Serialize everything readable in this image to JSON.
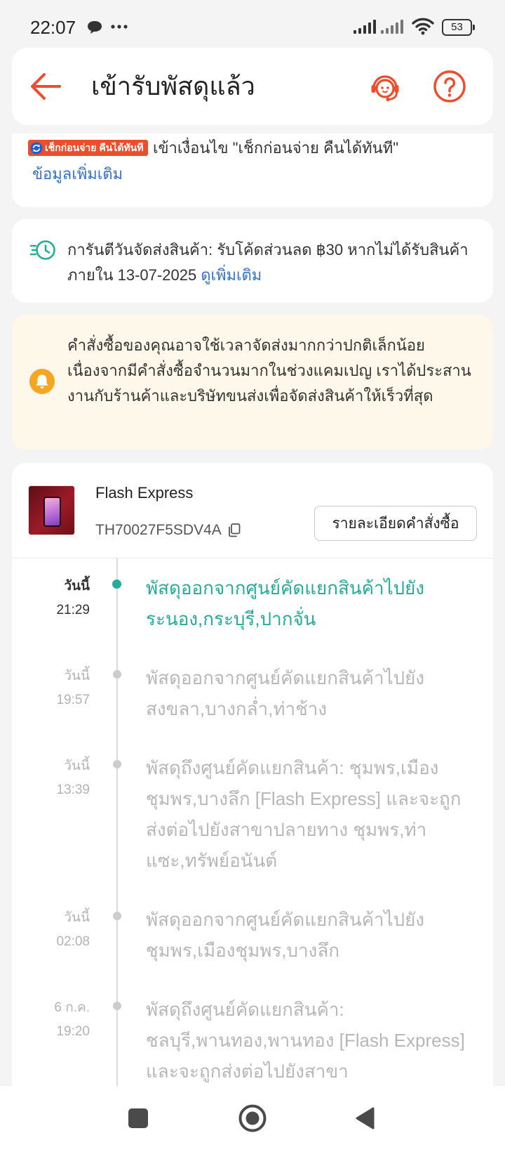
{
  "status_bar": {
    "time": "22:07",
    "battery_level": "53",
    "icons": [
      "chat-bubble-icon",
      "more-notifications-icon",
      "signal-icon",
      "signal-icon",
      "wifi-icon",
      "battery-icon"
    ]
  },
  "header": {
    "title": "เข้ารับพัสดุแล้ว",
    "icons": {
      "back": "back-arrow-icon",
      "support": "customer-support-icon",
      "help": "help-question-icon"
    }
  },
  "check_before_pay": {
    "badge": "เช็กก่อนจ่าย คืนได้ทันที",
    "text": "เข้าเงื่อนไข \"เช็กก่อนจ่าย คืนได้ทันที\"",
    "link": "ข้อมูลเพิ่มเติม",
    "icon": "refresh-arrows-icon"
  },
  "delivery_guarantee": {
    "text": "การันตีวันจัดส่งสินค้า: รับโค้ดส่วนลด ฿30 หากไม่ได้รับสินค้าภายใน 13-07-2025",
    "link": "ดูเพิ่มเติม",
    "icon": "fast-delivery-clock-icon"
  },
  "notice": {
    "text": "คำสั่งซื้อของคุณอาจใช้เวลาจัดส่งมากกว่าปกติเล็กน้อย เนื่องจากมีคำสั่งซื้อจำนวนมากในช่วงแคมเปญ เราได้ประสานงานกับร้านค้าและบริษัทขนส่งเพื่อจัดส่งสินค้าให้เร็วที่สุด",
    "icon": "bell-icon"
  },
  "shipment": {
    "carrier": "Flash Express",
    "tracking_number": "TH70027F5SDV4A",
    "order_details_button": "รายละเอียดคำสั่งซื้อ",
    "icons": {
      "thumbnail": "product-thumbnail",
      "copy": "copy-icon"
    }
  },
  "timeline": [
    {
      "day": "วันนี้",
      "time": "21:29",
      "description": "พัสดุออกจากศูนย์คัดแยกสินค้าไปยัง ระนอง,กระบุรี,ปากจั่น",
      "current": true
    },
    {
      "day": "วันนี้",
      "time": "19:57",
      "description": "พัสดุออกจากศูนย์คัดแยกสินค้าไปยัง สงขลา,บางกล่ำ,ท่าช้าง",
      "current": false
    },
    {
      "day": "วันนี้",
      "time": "13:39",
      "description": "พัสดุถึงศูนย์คัดแยกสินค้า: ชุมพร,เมืองชุมพร,บางลึก  [Flash Express] และจะถูกส่งต่อไปยังสาขาปลายทาง ชุมพร,ท่าแซะ,ทรัพย์อนันต์",
      "current": false
    },
    {
      "day": "วันนี้",
      "time": "02:08",
      "description": "พัสดุออกจากศูนย์คัดแยกสินค้าไปยัง ชุมพร,เมืองชุมพร,บางลึก",
      "current": false
    },
    {
      "day": "6 ก.ค.",
      "time": "19:20",
      "description": "พัสดุถึงศูนย์คัดแยกสินค้า: ชลบุรี,พานทอง,พานทอง  [Flash Express] และจะถูกส่งต่อไปยังสาขา",
      "current": false
    }
  ],
  "colors": {
    "accent": "#ee4d2d",
    "timeline_active": "#26aa99",
    "link": "#3572c6",
    "notice_background": "#fdf8ea",
    "notice_icon": "#f5a623",
    "badge": "#ee4d2d"
  },
  "nav_bar": {
    "icons": [
      "recent-apps-icon",
      "home-icon",
      "back-triangle-icon"
    ]
  }
}
